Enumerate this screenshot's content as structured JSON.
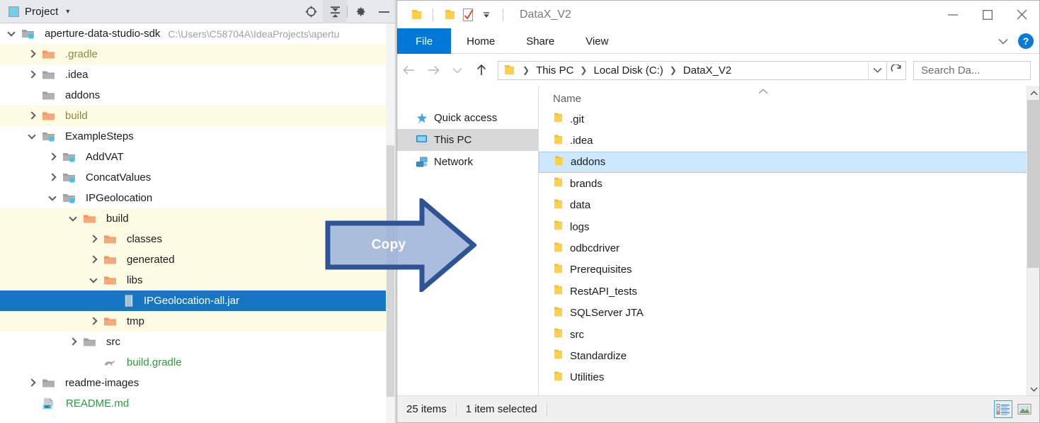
{
  "idea": {
    "header": {
      "title": "Project",
      "caret_icon": "chevron-down-icon",
      "panel_icon": "project-panel-icon",
      "tools": [
        {
          "name": "scroll-to-source-icon",
          "glyph": "target"
        },
        {
          "name": "collapse-all-icon",
          "glyph": "collapse"
        },
        {
          "name": "settings-gear-icon",
          "glyph": "gear"
        },
        {
          "name": "hide-panel-icon",
          "glyph": "minus"
        }
      ]
    },
    "tree": [
      {
        "label": "aperture-data-studio-sdk",
        "path_hint": "C:\\Users\\C58704A\\IdeaProjects\\apertu",
        "indent": 0,
        "twisty": "down",
        "icon": "module-folder-icon",
        "style": "plain",
        "row": "normal"
      },
      {
        "label": ".gradle",
        "path_hint": "",
        "indent": 1,
        "twisty": "right",
        "icon": "folder-orange-icon",
        "style": "olive",
        "row": "excluded"
      },
      {
        "label": ".idea",
        "path_hint": "",
        "indent": 1,
        "twisty": "right",
        "icon": "folder-grey-icon",
        "style": "plain",
        "row": "normal"
      },
      {
        "label": "addons",
        "path_hint": "",
        "indent": 1,
        "twisty": "none",
        "icon": "folder-grey-icon",
        "style": "plain",
        "row": "normal"
      },
      {
        "label": "build",
        "path_hint": "",
        "indent": 1,
        "twisty": "right",
        "icon": "folder-orange-icon",
        "style": "olive",
        "row": "excluded"
      },
      {
        "label": "ExampleSteps",
        "path_hint": "",
        "indent": 1,
        "twisty": "down",
        "icon": "module-folder-icon",
        "style": "plain",
        "row": "normal"
      },
      {
        "label": "AddVAT",
        "path_hint": "",
        "indent": 2,
        "twisty": "right",
        "icon": "module-folder-icon",
        "style": "plain",
        "row": "normal"
      },
      {
        "label": "ConcatValues",
        "path_hint": "",
        "indent": 2,
        "twisty": "right",
        "icon": "module-folder-icon",
        "style": "plain",
        "row": "normal"
      },
      {
        "label": "IPGeolocation",
        "path_hint": "",
        "indent": 2,
        "twisty": "down",
        "icon": "module-folder-icon",
        "style": "plain",
        "row": "normal"
      },
      {
        "label": "build",
        "path_hint": "",
        "indent": 3,
        "twisty": "down",
        "icon": "folder-orange-icon",
        "style": "plain",
        "row": "excluded"
      },
      {
        "label": "classes",
        "path_hint": "",
        "indent": 4,
        "twisty": "right",
        "icon": "folder-orange-icon",
        "style": "plain",
        "row": "excluded"
      },
      {
        "label": "generated",
        "path_hint": "",
        "indent": 4,
        "twisty": "right",
        "icon": "folder-orange-icon",
        "style": "plain",
        "row": "excluded"
      },
      {
        "label": "libs",
        "path_hint": "",
        "indent": 4,
        "twisty": "down",
        "icon": "folder-orange-icon",
        "style": "plain",
        "row": "excluded"
      },
      {
        "label": "IPGeolocation-all.jar",
        "path_hint": "",
        "indent": 5,
        "twisty": "none",
        "icon": "jar-file-icon",
        "style": "plain",
        "row": "selected"
      },
      {
        "label": "tmp",
        "path_hint": "",
        "indent": 4,
        "twisty": "right",
        "icon": "folder-orange-icon",
        "style": "plain",
        "row": "excluded"
      },
      {
        "label": "src",
        "path_hint": "",
        "indent": 3,
        "twisty": "right",
        "icon": "folder-grey-icon",
        "style": "plain",
        "row": "normal"
      },
      {
        "label": "build.gradle",
        "path_hint": "",
        "indent": 4,
        "twisty": "none",
        "icon": "gradle-file-icon",
        "style": "green",
        "row": "normal"
      },
      {
        "label": "readme-images",
        "path_hint": "",
        "indent": 1,
        "twisty": "right",
        "icon": "folder-grey-icon",
        "style": "plain",
        "row": "normal"
      },
      {
        "label": "README.md",
        "path_hint": "",
        "indent": 1,
        "twisty": "none",
        "icon": "markdown-file-icon",
        "style": "green",
        "row": "normal"
      }
    ]
  },
  "explorer": {
    "titlebar": {
      "title": "DataX_V2",
      "quick_access": [
        {
          "name": "folder-icon",
          "glyph": "folder"
        },
        {
          "name": "folder-properties-icon",
          "glyph": "folder"
        },
        {
          "name": "checkbox-check-icon",
          "glyph": "check-doc"
        },
        {
          "name": "customize-toolbar-caret-icon",
          "glyph": "caret"
        }
      ],
      "window_controls": [
        {
          "name": "minimize-button",
          "glyph": "minimize"
        },
        {
          "name": "maximize-button",
          "glyph": "maximize"
        },
        {
          "name": "close-button",
          "glyph": "close"
        }
      ]
    },
    "ribbon": {
      "tabs": [
        {
          "label": "File",
          "active": true
        },
        {
          "label": "Home",
          "active": false
        },
        {
          "label": "Share",
          "active": false
        },
        {
          "label": "View",
          "active": false
        }
      ],
      "collapse_icon": "chevron-down-icon",
      "help_label": "?"
    },
    "addressbar": {
      "nav": [
        {
          "name": "back-button",
          "glyph": "back",
          "enabled": false
        },
        {
          "name": "forward-button",
          "glyph": "forward",
          "enabled": false
        },
        {
          "name": "recent-locations-button",
          "glyph": "caret",
          "enabled": false
        },
        {
          "name": "up-button",
          "glyph": "up",
          "enabled": true
        }
      ],
      "breadcrumb_icon": "folder-icon",
      "breadcrumbs": [
        "This PC",
        "Local Disk (C:)",
        "DataX_V2"
      ],
      "dropdown_icon": "chevron-down-icon",
      "refresh_icon": "refresh-icon",
      "search_placeholder": "Search Da...",
      "search_value": "",
      "search_icon": "search-icon"
    },
    "navpane": [
      {
        "label": "Quick access",
        "icon": "star-pin-icon",
        "active": false
      },
      {
        "label": "This PC",
        "icon": "monitor-icon",
        "active": true
      },
      {
        "label": "Network",
        "icon": "network-icon",
        "active": false
      }
    ],
    "filelist": {
      "column_header": "Name",
      "sort_indicator": "sort-ascending-icon",
      "items": [
        {
          "name": ".git",
          "icon": "folder-icon",
          "selected": false
        },
        {
          "name": ".idea",
          "icon": "folder-icon",
          "selected": false
        },
        {
          "name": "addons",
          "icon": "folder-icon",
          "selected": true
        },
        {
          "name": "brands",
          "icon": "folder-icon",
          "selected": false
        },
        {
          "name": "data",
          "icon": "folder-icon",
          "selected": false
        },
        {
          "name": "logs",
          "icon": "folder-icon",
          "selected": false
        },
        {
          "name": "odbcdriver",
          "icon": "folder-icon",
          "selected": false
        },
        {
          "name": "Prerequisites",
          "icon": "folder-icon",
          "selected": false
        },
        {
          "name": "RestAPI_tests",
          "icon": "folder-icon",
          "selected": false
        },
        {
          "name": "SQLServer JTA",
          "icon": "folder-icon",
          "selected": false
        },
        {
          "name": "src",
          "icon": "folder-icon",
          "selected": false
        },
        {
          "name": "Standardize",
          "icon": "folder-icon",
          "selected": false
        },
        {
          "name": "Utilities",
          "icon": "folder-icon",
          "selected": false
        }
      ]
    },
    "scrollbar": {
      "up_icon": "chevron-up-icon",
      "down_icon": "chevron-down-icon"
    },
    "statusbar": {
      "item_count": "25 items",
      "selection": "1 item selected",
      "views": [
        {
          "name": "details-view-button",
          "icon": "details-view-icon",
          "active": true
        },
        {
          "name": "large-icons-view-button",
          "icon": "large-icons-view-icon",
          "active": false
        }
      ]
    }
  },
  "annotation": {
    "label": "Copy",
    "fill_color": "#9CB2D8",
    "border_color": "#2F5496",
    "text_color": "#FFFFFF"
  },
  "colors": {
    "idea_header_bg": "#E6E9EE",
    "idea_selected_row": "#1776C4",
    "idea_excluded_row": "#FDFBE4",
    "idea_excluded_text": "#8A8C3F",
    "idea_green_text": "#2E9B3E",
    "explorer_accent": "#0078D7",
    "explorer_selected_row": "#CCE8FF",
    "explorer_nav_active": "#D8D8D8",
    "folder_yellow": "#FFD04B",
    "folder_orange": "#F2A374"
  }
}
